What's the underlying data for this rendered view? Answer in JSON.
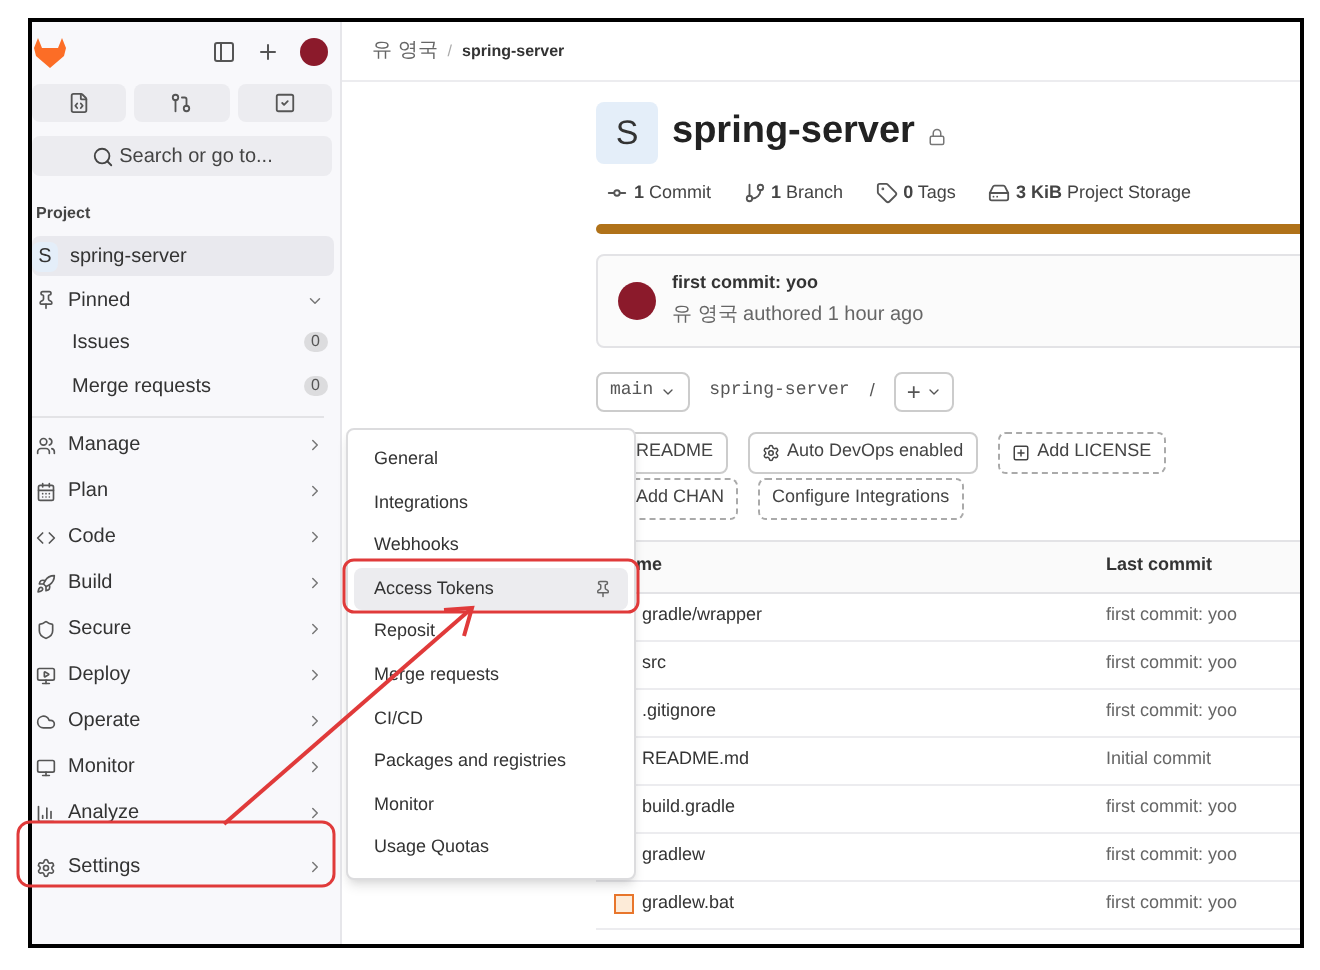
{
  "sidebar": {
    "search": {
      "placeholder": "Search or go to..."
    },
    "section_title": "Project",
    "project": {
      "initial": "S",
      "name": "spring-server",
      "selected": true
    },
    "pinned": {
      "label": "Pinned",
      "expanded": true,
      "items": [
        {
          "label": "Issues",
          "count": "0"
        },
        {
          "label": "Merge requests",
          "count": "0"
        }
      ]
    },
    "nav": [
      {
        "label": "Manage",
        "selected": false
      },
      {
        "label": "Plan",
        "selected": false
      },
      {
        "label": "Code",
        "selected": false
      },
      {
        "label": "Build",
        "selected": false
      },
      {
        "label": "Secure",
        "selected": false
      },
      {
        "label": "Deploy",
        "selected": false
      },
      {
        "label": "Operate",
        "selected": false
      },
      {
        "label": "Monitor",
        "selected": false
      },
      {
        "label": "Analyze",
        "selected": false
      },
      {
        "label": "Settings",
        "selected": false
      }
    ]
  },
  "breadcrumb": [
    {
      "label": "유 영국",
      "current": false
    },
    {
      "label": "spring-server",
      "current": true
    }
  ],
  "breadcrumb_separator": "/",
  "project": {
    "initial": "S",
    "name": "spring-server",
    "stats": [
      {
        "kind": "commit",
        "text": "**1** Commit"
      },
      {
        "kind": "branch",
        "text": "**1** Branch"
      },
      {
        "kind": "tag",
        "text": "**0** Tags"
      },
      {
        "kind": "storage",
        "text": "**3 KiB** Project Storage"
      }
    ]
  },
  "last_commit": {
    "message": "first commit: yoo",
    "byline": "유 영국 authored 1 hour ago"
  },
  "repo_bar": {
    "branch": "main",
    "path": "spring-server",
    "separator": "/",
    "add": "+"
  },
  "actions": [
    {
      "label": "README",
      "kind": "existing"
    },
    {
      "label": "Auto DevOps enabled",
      "kind": "devops"
    },
    {
      "label": "Add LICENSE",
      "kind": "add"
    },
    {
      "label": "Add CHAN",
      "kind": "add"
    },
    {
      "label": "Configure Integrations",
      "kind": "suggestion"
    }
  ],
  "table": {
    "columns": [
      "me",
      "Last commit"
    ],
    "rows": [
      {
        "kind": "folder",
        "name": "gradle/wrapper",
        "commit": "first commit: yoo"
      },
      {
        "kind": "folder",
        "name": "src",
        "commit": "first commit: yoo"
      },
      {
        "kind": "git",
        "name": ".gitignore",
        "commit": "first commit: yoo"
      },
      {
        "kind": "markdown",
        "name": "README.md",
        "commit": "Initial commit"
      },
      {
        "kind": "gradle",
        "name": "build.gradle",
        "commit": "first commit: yoo"
      },
      {
        "kind": "elephant",
        "name": "gradlew",
        "commit": "first commit: yoo"
      },
      {
        "kind": "script",
        "name": "gradlew.bat",
        "commit": "first commit: yoo"
      }
    ]
  },
  "settings_menu": [
    {
      "label": "General",
      "highlighted": false
    },
    {
      "label": "Integrations",
      "highlighted": false
    },
    {
      "label": "Webhooks",
      "highlighted": false
    },
    {
      "label": "Access Tokens",
      "highlighted": true
    },
    {
      "label": "Reposit",
      "highlighted": false
    },
    {
      "label": "Merge requests",
      "highlighted": false
    },
    {
      "label": "CI/CD",
      "highlighted": false
    },
    {
      "label": "Packages and registries",
      "highlighted": false
    },
    {
      "label": "Monitor",
      "highlighted": false
    },
    {
      "label": "Usage Quotas",
      "highlighted": false
    }
  ]
}
